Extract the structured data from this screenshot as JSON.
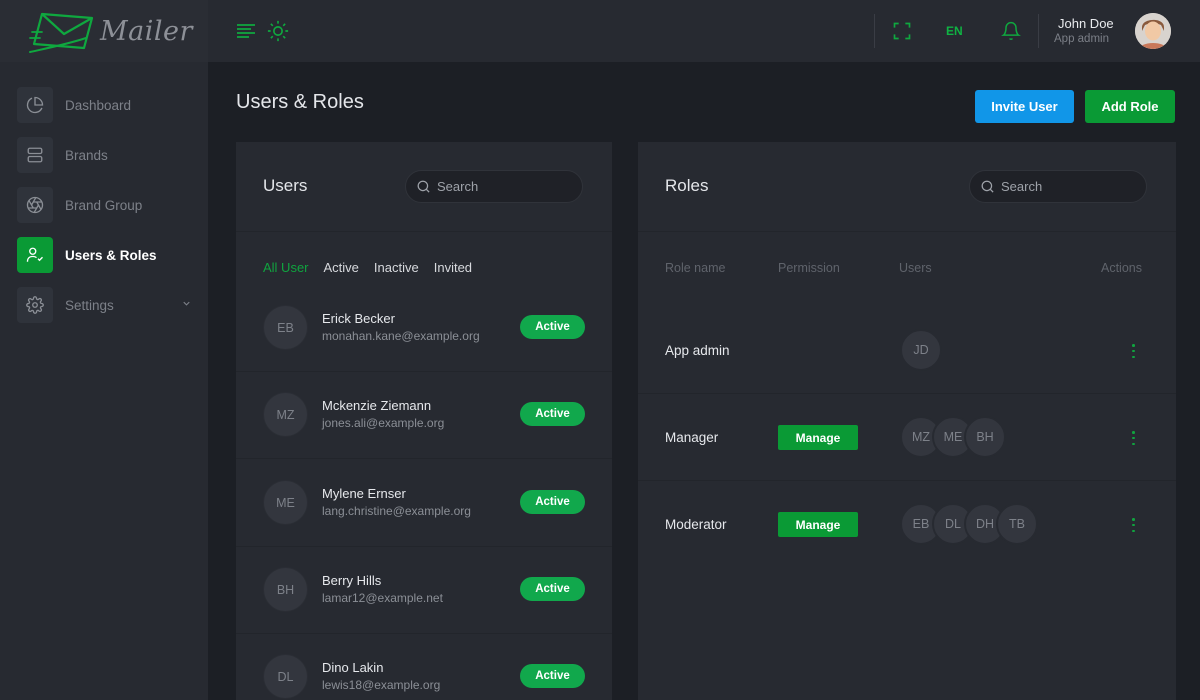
{
  "app": {
    "name": "Mailer"
  },
  "sidebar": {
    "items": [
      {
        "label": "Dashboard",
        "icon": "pie-chart-icon"
      },
      {
        "label": "Brands",
        "icon": "server-icon"
      },
      {
        "label": "Brand Group",
        "icon": "aperture-icon"
      },
      {
        "label": "Users & Roles",
        "icon": "user-check-icon",
        "active": true
      },
      {
        "label": "Settings",
        "icon": "gear-icon"
      }
    ]
  },
  "topbar": {
    "language": "EN",
    "user": {
      "name": "John Doe",
      "role": "App admin"
    }
  },
  "page": {
    "title": "Users & Roles",
    "invite_label": "Invite User",
    "add_role_label": "Add Role"
  },
  "users_panel": {
    "title": "Users",
    "search_placeholder": "Search",
    "tabs": [
      "All User",
      "Active",
      "Inactive",
      "Invited"
    ],
    "active_tab": "All User",
    "rows": [
      {
        "initials": "EB",
        "name": "Erick Becker",
        "email": "monahan.kane@example.org",
        "status": "Active"
      },
      {
        "initials": "MZ",
        "name": "Mckenzie Ziemann",
        "email": "jones.ali@example.org",
        "status": "Active"
      },
      {
        "initials": "ME",
        "name": "Mylene Ernser",
        "email": "lang.christine@example.org",
        "status": "Active"
      },
      {
        "initials": "BH",
        "name": "Berry Hills",
        "email": "lamar12@example.net",
        "status": "Active"
      },
      {
        "initials": "DL",
        "name": "Dino Lakin",
        "email": "lewis18@example.org",
        "status": "Active"
      }
    ]
  },
  "roles_panel": {
    "title": "Roles",
    "search_placeholder": "Search",
    "columns": [
      "Role name",
      "Permission",
      "Users",
      "Actions"
    ],
    "rows": [
      {
        "name": "App admin",
        "permission": "",
        "users": [
          "JD"
        ]
      },
      {
        "name": "Manager",
        "permission": "Manage",
        "users": [
          "MZ",
          "ME",
          "BH"
        ]
      },
      {
        "name": "Moderator",
        "permission": "Manage",
        "users": [
          "EB",
          "DL",
          "DH",
          "TB"
        ]
      }
    ]
  },
  "colors": {
    "accent_green": "#0a9a35",
    "status_green": "#11a84c",
    "accent_blue": "#1196e8",
    "background": "#1c1f25",
    "panel": "#272a31"
  }
}
